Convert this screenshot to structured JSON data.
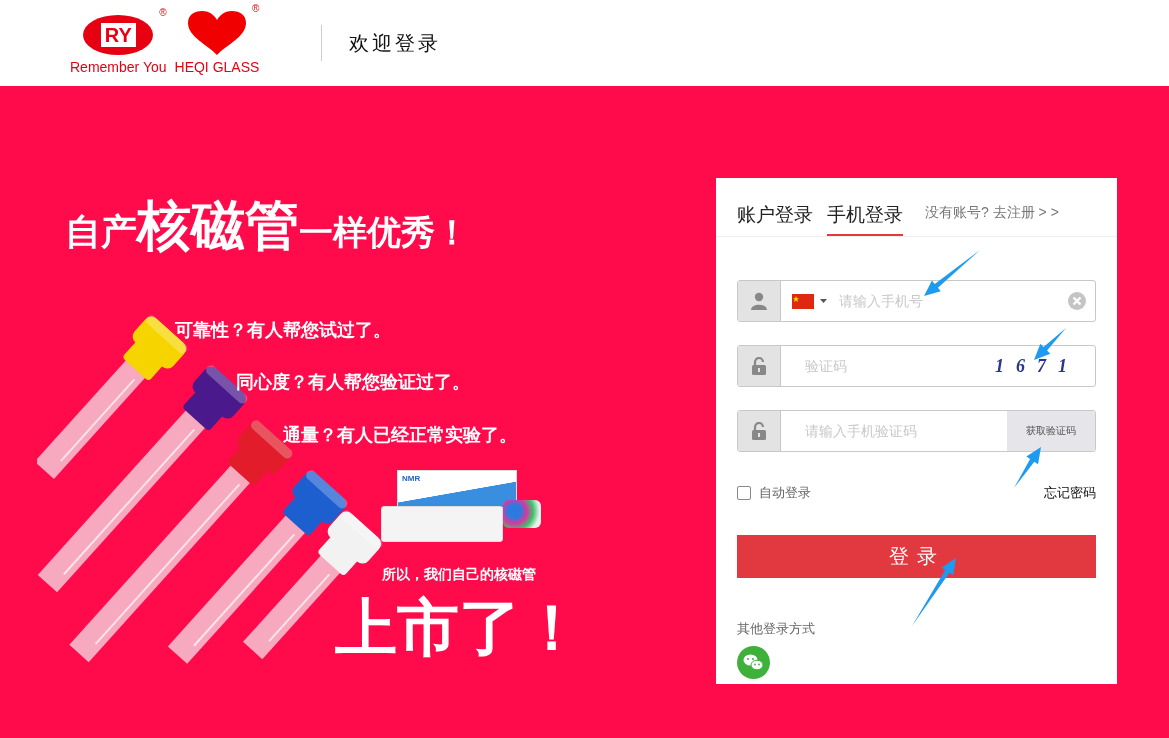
{
  "header": {
    "logo_ry": {
      "mark": "RY",
      "registered": "®",
      "caption": "Remember You"
    },
    "logo_heart": {
      "registered": "®",
      "caption": "HEQI GLASS"
    },
    "title": "欢迎登录"
  },
  "banner": {
    "headline": [
      {
        "kind": "small",
        "text": "自产"
      },
      {
        "kind": "large",
        "text": "核磁管"
      },
      {
        "kind": "medium",
        "text": "一样优秀！"
      }
    ],
    "slogans": [
      "可靠性？有人帮您试过了。",
      "同心度？有人帮您验证过了。",
      "通量？有人已经正常实验了。"
    ],
    "box_label": "NMR",
    "tagline": "所以，我们自己的核磁管",
    "big_text": "上市了！"
  },
  "login": {
    "tabs": [
      {
        "label": "账户登录",
        "selected": false
      },
      {
        "label": "手机登录",
        "selected": true
      }
    ],
    "register_link": "没有账号? 去注册 > >",
    "fields": [
      {
        "kind": "phone",
        "placeholder": "请输入手机号"
      },
      {
        "kind": "captcha",
        "placeholder": "验证码",
        "captcha": "1671"
      },
      {
        "kind": "sms",
        "placeholder": "请输入手机验证码",
        "button": "获取验证码"
      }
    ],
    "auto_login": {
      "label": "自动登录",
      "checked": false
    },
    "forgot": "忘记密码",
    "submit": "登录",
    "other_label": "其他登录方式"
  }
}
